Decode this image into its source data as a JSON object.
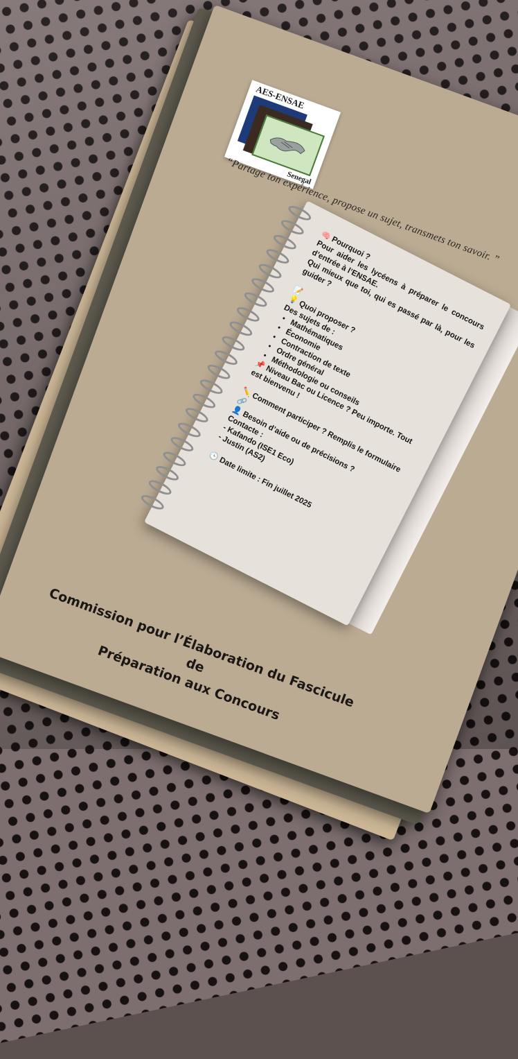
{
  "logo": {
    "top_text": "AES-ENSAE",
    "bottom_text": "Senegal"
  },
  "quote": "“Partage ton expérience, propose un sujet, transmets ton savoir. ”",
  "notebook": {
    "why_title": "Pourquoi ?",
    "why_text": "Pour aider les lycéens à préparer le concours d’entrée à l’ENSAE.",
    "why_text2": "Qui mieux que toi, qui es passé par là, pour les guider ?",
    "what_title": "Quoi proposer ?",
    "subjects_label": "Des sujets de :",
    "subjects": [
      "Mathématiques",
      "Économie",
      "Contraction de texte",
      "Ordre général",
      "Méthodologie ou conseils"
    ],
    "level_text": "Niveau Bac ou Licence ? Peu importe. Tout est bienvenu !",
    "participate_text": "Comment participer ? Remplis le formulaire",
    "help_text": "Besoin d’aide ou de précisions ?",
    "contact_label": "Contacte :",
    "contact_1": "- Kafando (ISE1 Eco)",
    "contact_2": "- Justin (AS2)",
    "deadline": "Date limite : Fin juillet 2025"
  },
  "commission": {
    "line1": "Commission pour l’Élaboration du Fascicule de",
    "line2": "Préparation aux Concours"
  },
  "icons": [
    "brain-icon",
    "clipboard-icon",
    "lightbulb-icon",
    "pin-icon",
    "pencil-icon",
    "person-icon",
    "link-icon",
    "clock-icon"
  ]
}
